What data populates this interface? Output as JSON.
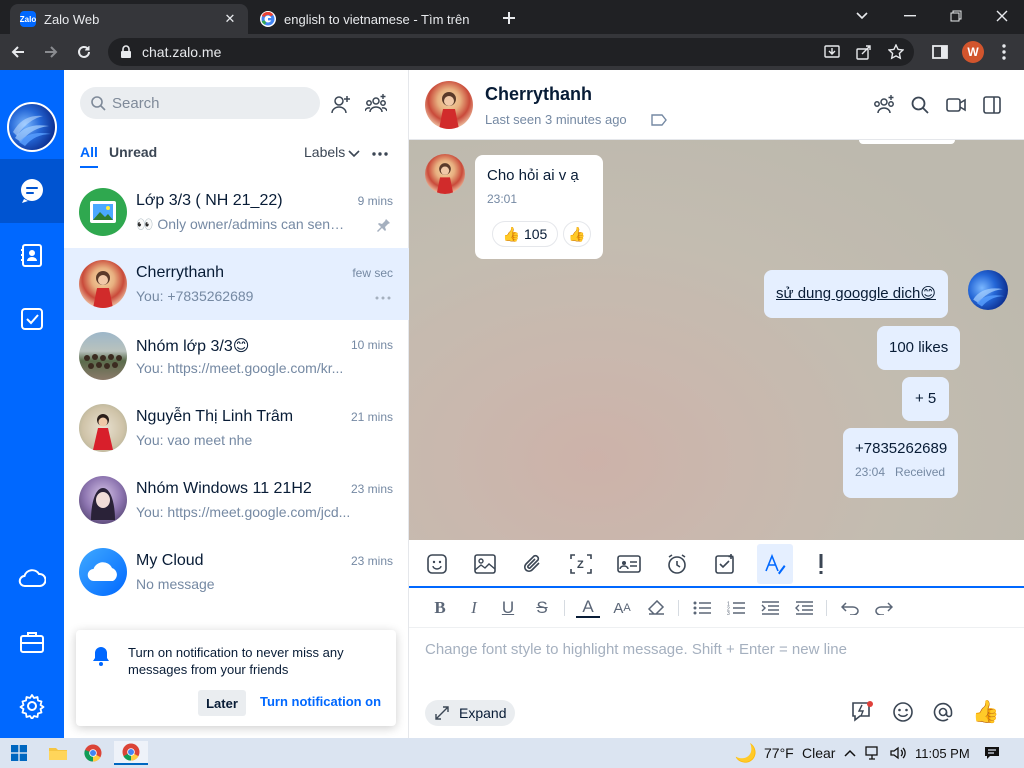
{
  "browser": {
    "tabs": [
      {
        "title": "Zalo Web",
        "favicon": "zalo-favicon",
        "active": true
      },
      {
        "title": "english to vietnamese - Tìm trên",
        "favicon": "google-favicon",
        "active": false
      }
    ],
    "url": "chat.zalo.me",
    "profile_initial": "W"
  },
  "search": {
    "placeholder": "Search"
  },
  "filters": {
    "all": "All",
    "unread": "Unread",
    "labels": "Labels"
  },
  "conversations": [
    {
      "name": "Lớp 3/3 ( NH 21_22)",
      "message": "👀 Only owner/admins can send ...",
      "time": "9 mins",
      "pinned": true
    },
    {
      "name": "Cherrythanh",
      "message": "You: +7835262689",
      "time": "few sec",
      "selected": true
    },
    {
      "name": "Nhóm lớp 3/3😊",
      "message": "You: https://meet.google.com/kr...",
      "time": "10 mins"
    },
    {
      "name": "Nguyễn Thị Linh Trâm",
      "message": "You: vao meet nhe",
      "time": "21 mins"
    },
    {
      "name": "Nhóm Windows 11 21H2",
      "message": "You: https://meet.google.com/jcd...",
      "time": "23 mins"
    },
    {
      "name": "My Cloud",
      "message": "No message",
      "time": "23 mins"
    }
  ],
  "notification": {
    "text": "Turn on notification to never miss any messages from your friends",
    "later": "Later",
    "turn_on": "Turn notification on"
  },
  "chat": {
    "name": "Cherrythanh",
    "last_seen": "Last seen 3 minutes ago",
    "messages": [
      {
        "from": "them",
        "text": "Cho hỏi ai v ạ",
        "time": "23:01",
        "reaction_count": "105"
      },
      {
        "from": "me",
        "text": "sử dung googgle dich😊"
      },
      {
        "from": "me",
        "text": "100 likes"
      },
      {
        "from": "me",
        "text": "+ 5"
      },
      {
        "from": "me",
        "text": "+7835262689",
        "time": "23:04",
        "status": "Received"
      }
    ]
  },
  "composer": {
    "placeholder": "Change font style to highlight message. Shift + Enter = new line",
    "expand": "Expand"
  },
  "taskbar": {
    "temperature": "77°F",
    "weather": "Clear",
    "time": "11:05 PM"
  },
  "colors": {
    "brand": "#0068ff",
    "selected_bg": "#e5efff"
  }
}
